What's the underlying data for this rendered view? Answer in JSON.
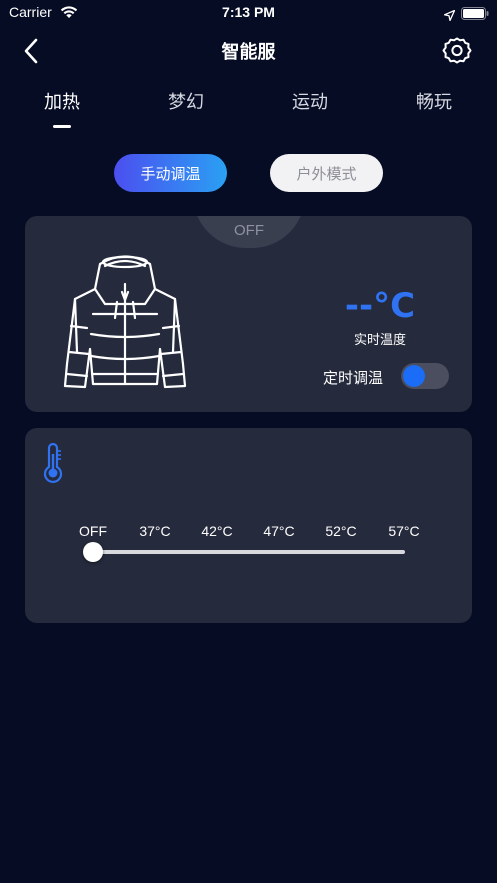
{
  "status_bar": {
    "carrier": "Carrier",
    "time": "7:13 PM"
  },
  "nav": {
    "title": "智能服",
    "back_icon": "chevron-left-icon",
    "settings_icon": "gear-icon"
  },
  "mode_tabs": [
    {
      "label": "加热",
      "active": true
    },
    {
      "label": "梦幻",
      "active": false
    },
    {
      "label": "运动",
      "active": false
    },
    {
      "label": "畅玩",
      "active": false
    }
  ],
  "control_modes": {
    "manual": "手动调温",
    "outdoor": "户外模式",
    "selected": "manual"
  },
  "status_card": {
    "power_state": "OFF",
    "temperature": "--°C",
    "temperature_label": "实时温度",
    "timer_label": "定时调温",
    "timer_enabled": false
  },
  "slider": {
    "ticks": [
      "OFF",
      "37°C",
      "42°C",
      "47°C",
      "52°C",
      "57°C"
    ],
    "selected": "OFF"
  },
  "colors": {
    "background": "#060c24",
    "card": "#252a3c",
    "accent_blue": "#2f72f2",
    "gradient_start": "#4b4ff0",
    "gradient_end": "#2aa0f3"
  }
}
